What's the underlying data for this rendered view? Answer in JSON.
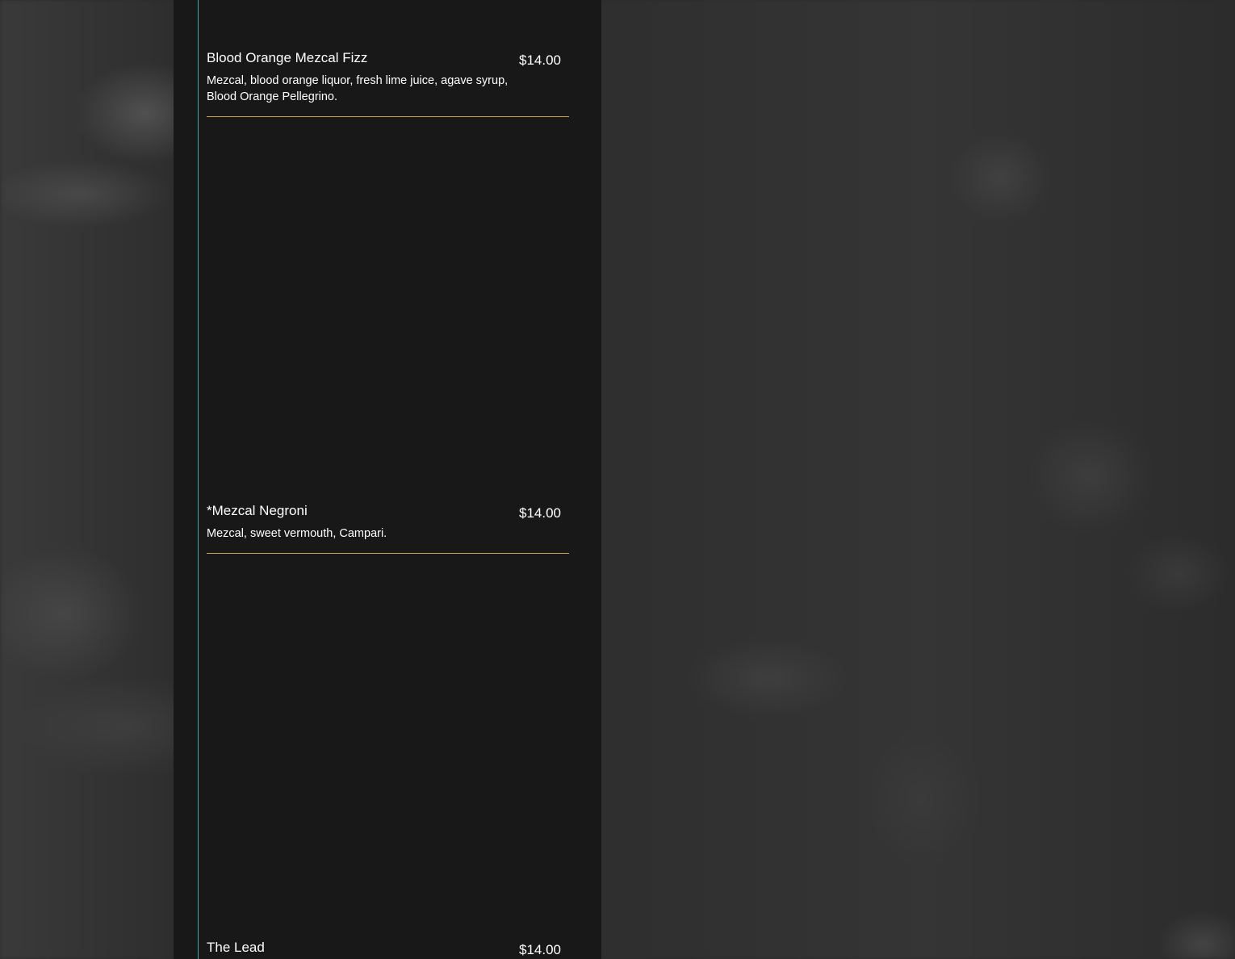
{
  "menu": {
    "items": [
      {
        "name": "Blood Orange Mezcal Fizz",
        "price": "$14.00",
        "description": "Mezcal, blood orange liquor, fresh lime juice, agave syrup, Blood Orange Pellegrino."
      },
      {
        "name": "*Mezcal Negroni",
        "price": "$14.00",
        "description": "Mezcal, sweet vermouth, Campari."
      },
      {
        "name": "The Lead",
        "price": "$14.00"
      }
    ]
  },
  "colors": {
    "panel_background": "#181818",
    "accent_line": "#3aa7a3",
    "divider": "#c9a24a",
    "text": "#ffffff"
  }
}
